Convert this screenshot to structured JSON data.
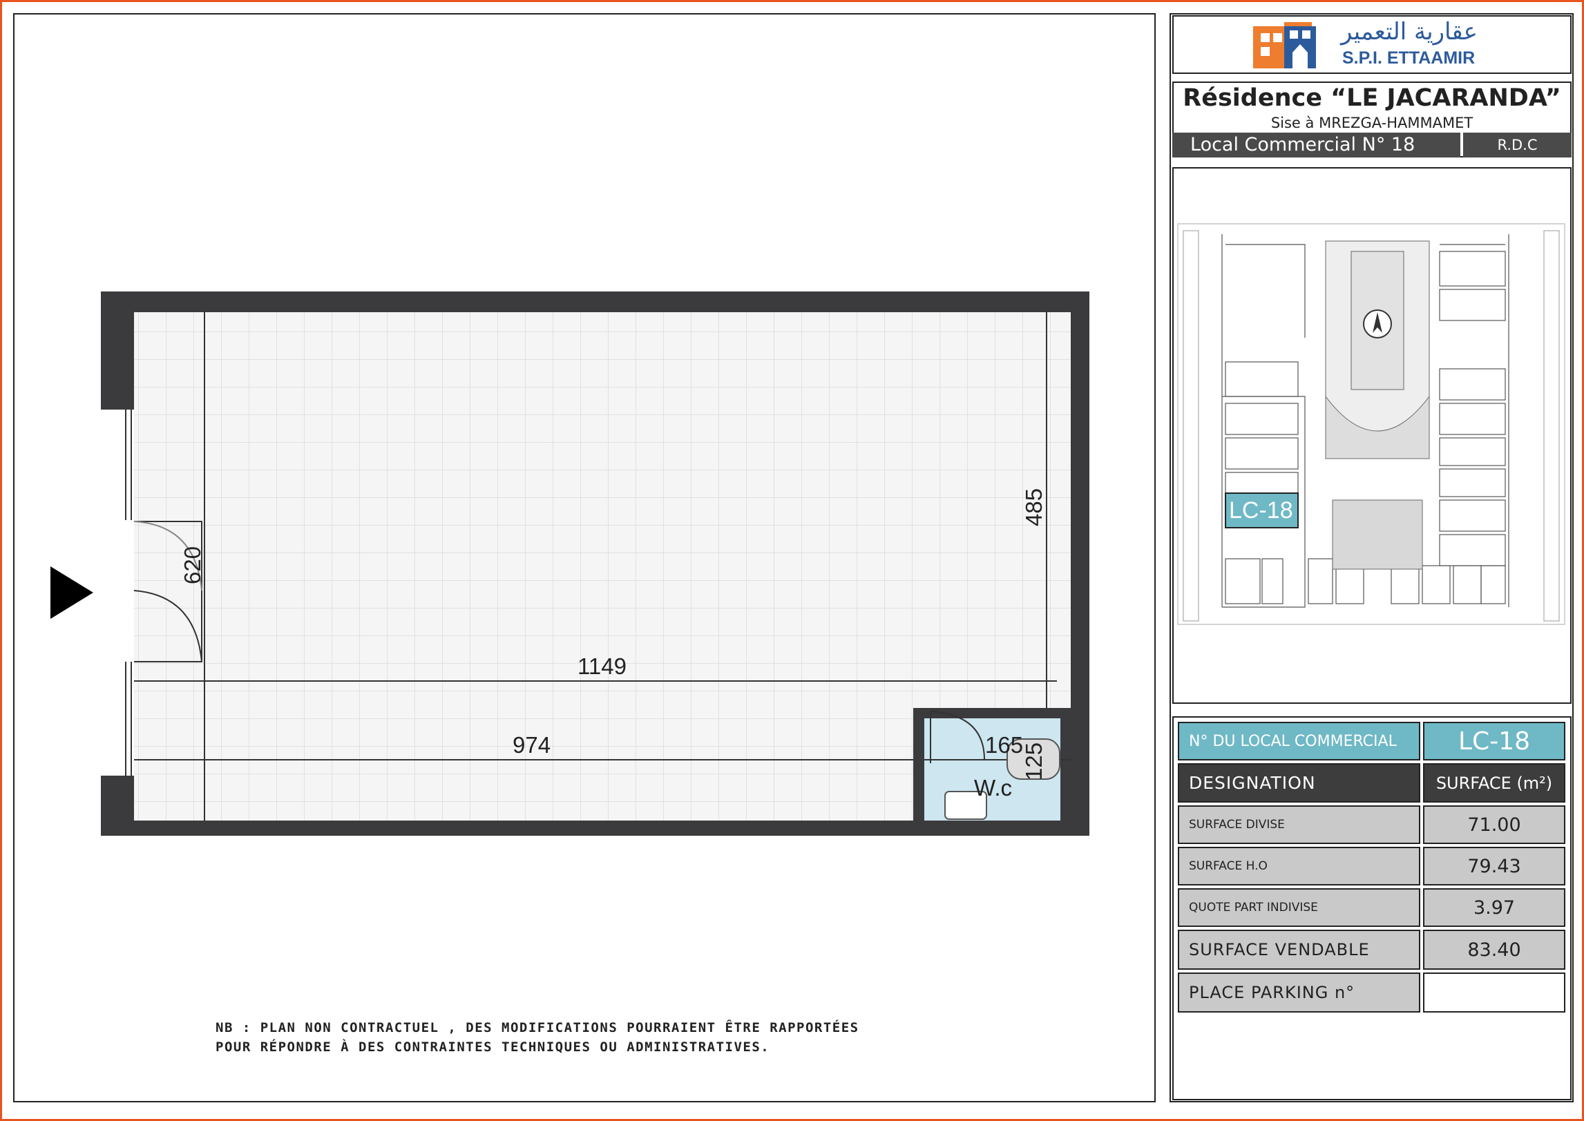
{
  "company": {
    "arabic_name": "عقارية التعمير",
    "latin_name": "S.P.I. ETTAAMIR"
  },
  "header": {
    "residence_title": "Résidence “LE JACARANDA”",
    "location": "Sise à MREZGA-HAMMAMET",
    "local_label": "Local Commercial  N° 18",
    "level": "R.D.C"
  },
  "site_plan": {
    "highlight_label": "LC-18",
    "highlight_color": "#6fb8c6"
  },
  "floor_plan": {
    "dimensions": {
      "total_length": "1149",
      "partial_length": "974",
      "door_width": "620",
      "depth": "485",
      "wc_width": "165",
      "wc_depth": "125"
    },
    "room_label": "W.c"
  },
  "table": {
    "local_number_label": "N° DU LOCAL COMMERCIAL",
    "local_number_value": "LC-18",
    "col_designation": "DESIGNATION",
    "col_surface": "SURFACE (m²)",
    "rows": [
      {
        "label": "SURFACE DIVISE",
        "value": "71.00"
      },
      {
        "label": "SURFACE H.O",
        "value": "79.43"
      },
      {
        "label": "QUOTE PART INDIVISE",
        "value": "3.97"
      },
      {
        "label": "SURFACE VENDABLE",
        "value": "83.40"
      },
      {
        "label": "PLACE PARKING n°",
        "value": ""
      }
    ]
  },
  "note": {
    "line1": "NB : PLAN NON CONTRACTUEL , DES MODIFICATIONS POURRAIENT ÊTRE RAPPORTÉES",
    "line2": "POUR RÉPONDRE À DES CONTRAINTES TECHNIQUES OU ADMINISTRATIVES."
  },
  "colors": {
    "frame": "#e8541e",
    "wall": "#3b3b3d",
    "floor": "#f4f5f4",
    "wc_floor": "#cde6f0",
    "logo_orange": "#ee7d2f",
    "logo_blue": "#2c5b9c",
    "header_bar": "#4a4a4a"
  }
}
